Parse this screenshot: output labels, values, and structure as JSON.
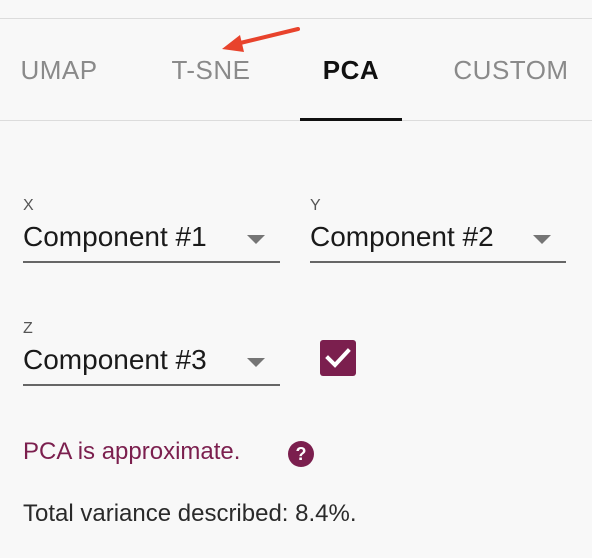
{
  "tabs": [
    {
      "label": "UMAP"
    },
    {
      "label": "T-SNE"
    },
    {
      "label": "PCA"
    },
    {
      "label": "CUSTOM"
    }
  ],
  "active_tab": "PCA",
  "fields": {
    "x": {
      "label": "X",
      "value": "Component #1"
    },
    "y": {
      "label": "Y",
      "value": "Component #2"
    },
    "z": {
      "label": "Z",
      "value": "Component #3"
    }
  },
  "z_enabled": true,
  "note": {
    "text": "PCA is approximate.",
    "help_glyph": "?"
  },
  "variance_text": "Total variance described: 8.4%.",
  "colors": {
    "accent": "#7b1f4e",
    "annotation_arrow": "#e8432c",
    "active_tab": "#111111",
    "inactive_tab": "#8a8a8a"
  },
  "icons": {
    "dropdown": "chevron-down-icon",
    "checkbox": "checkmark-icon",
    "help": "help-circle-icon",
    "annotation": "annotation-arrow-icon"
  }
}
